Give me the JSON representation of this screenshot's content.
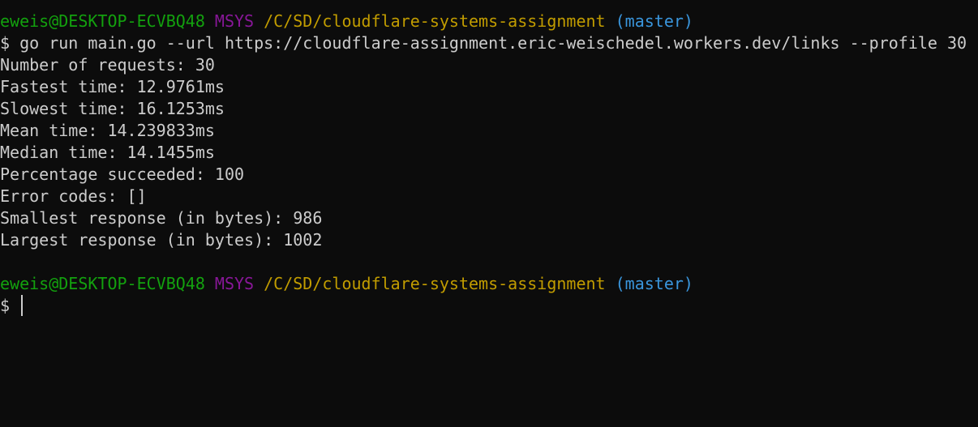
{
  "colors": {
    "background": "#0c0c0c",
    "text": "#cccccc",
    "user": "#13a10e",
    "system": "#881798",
    "path": "#c19c00",
    "branch": "#3a96dd"
  },
  "prompts": [
    {
      "user": "eweis@DESKTOP-ECVBQ48",
      "system": "MSYS",
      "path": "/C/SD/cloudflare-systems-assignment",
      "branch": "(master)",
      "symbol": "$",
      "command": "go run main.go --url https://cloudflare-assignment.eric-weischedel.workers.dev/links --profile 30"
    },
    {
      "user": "eweis@DESKTOP-ECVBQ48",
      "system": "MSYS",
      "path": "/C/SD/cloudflare-systems-assignment",
      "branch": "(master)",
      "symbol": "$",
      "command": ""
    }
  ],
  "output": [
    "Number of requests: 30",
    "Fastest time: 12.9761ms",
    "Slowest time: 16.1253ms",
    "Mean time: 14.239833ms",
    "Median time: 14.1455ms",
    "Percentage succeeded: 100",
    "Error codes: []",
    "Smallest response (in bytes): 986",
    "Largest response (in bytes): 1002"
  ]
}
